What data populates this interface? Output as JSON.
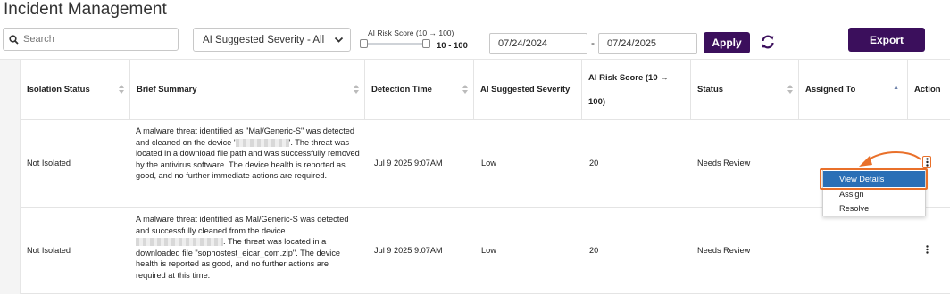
{
  "page": {
    "title": "Incident Management"
  },
  "filters": {
    "search_placeholder": "Search",
    "severity_selected": "AI Suggested Severity - All",
    "risk_label": "AI Risk Score (10 → 100)",
    "risk_range_text": "10 - 100",
    "risk_min": 10,
    "risk_max": 100,
    "date_from": "07/24/2024",
    "date_sep": "-",
    "date_to": "07/24/2025",
    "apply_label": "Apply",
    "export_label": "Export"
  },
  "table": {
    "columns": [
      {
        "label": "Isolation Status"
      },
      {
        "label": "Brief Summary"
      },
      {
        "label": "Detection Time"
      },
      {
        "label": "AI Suggested Severity"
      },
      {
        "label": "AI Risk Score (10 →",
        "label2": "100)"
      },
      {
        "label": "Status"
      },
      {
        "label": "Assigned To"
      },
      {
        "label": "Action"
      }
    ],
    "rows": [
      {
        "isolation": "Not Isolated",
        "summary_parts": [
          "A malware threat identified as \"Mal/Generic-S\" was detected and cleaned on the device '",
          "'. The threat was located in a download file path and was successfully removed by the antivirus software. The device health is reported as good, and no further immediate actions are required."
        ],
        "detection_time": "Jul 9 2025 9:07AM",
        "severity": "Low",
        "risk_score": "20",
        "status": "Needs Review",
        "assigned_to": ""
      },
      {
        "isolation": "Not Isolated",
        "summary_parts": [
          "A malware threat identified as Mal/Generic-S was detected and successfully cleaned from the device",
          ". The threat was located in a downloaded file \"sophostest_eicar_com.zip\". The device health is reported as good, and no further actions are required at this time."
        ],
        "detection_time": "Jul 9 2025 9:07AM",
        "severity": "Low",
        "risk_score": "20",
        "status": "Needs Review",
        "assigned_to": ""
      }
    ]
  },
  "action_menu": {
    "items": [
      "View Details",
      "Assign",
      "Resolve"
    ],
    "active_index": 0
  },
  "colors": {
    "primary": "#3b0f5c",
    "highlight": "#e9702a",
    "menu_active": "#2a6fb6"
  }
}
